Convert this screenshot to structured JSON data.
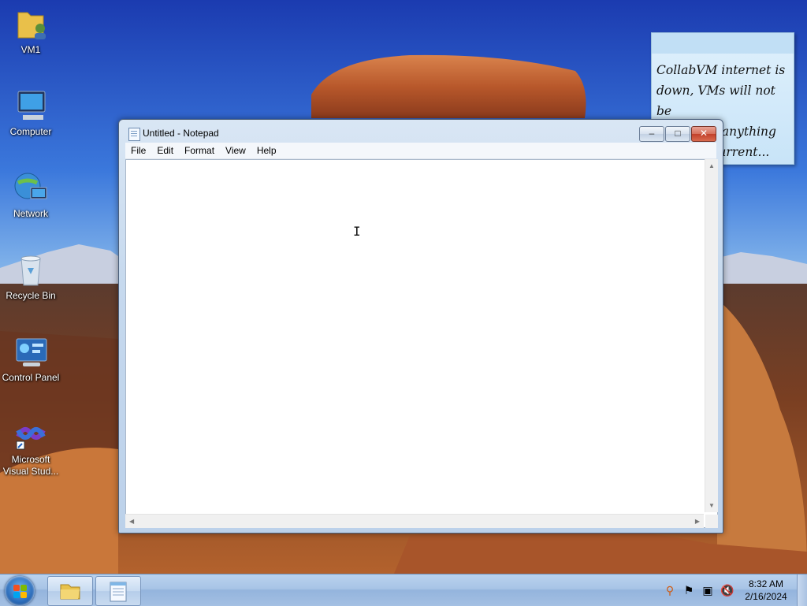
{
  "desktop": {
    "icons": [
      {
        "label": "VM1",
        "icon": "user-folder-icon"
      },
      {
        "label": "Computer",
        "icon": "computer-icon"
      },
      {
        "label": "Network",
        "icon": "network-icon"
      },
      {
        "label": "Recycle Bin",
        "icon": "recycle-bin-icon"
      },
      {
        "label": "Control Panel",
        "icon": "control-panel-icon"
      },
      {
        "label": "Microsoft\nVisual Stud...",
        "label_line1": "Microsoft",
        "label_line2": "Visual Stud...",
        "icon": "visual-studio-icon"
      }
    ]
  },
  "sticky_note": {
    "text": "CollabVM internet is\ndown, VMs will not be\nable to do anything\nwith the current..."
  },
  "notepad": {
    "title": "Untitled - Notepad",
    "menu": [
      "File",
      "Edit",
      "Format",
      "View",
      "Help"
    ],
    "content": "",
    "buttons": {
      "minimize": "–",
      "maximize": "□",
      "close": "✕"
    }
  },
  "taskbar": {
    "pinned": [
      {
        "name": "Windows Explorer",
        "icon": "folder-icon"
      },
      {
        "name": "Notepad",
        "icon": "notepad-icon"
      }
    ],
    "tray_icons": [
      "search-icon",
      "action-center-flag-icon",
      "network-icon",
      "volume-muted-icon"
    ],
    "clock": {
      "time": "8:32 AM",
      "date": "2/16/2024"
    }
  }
}
